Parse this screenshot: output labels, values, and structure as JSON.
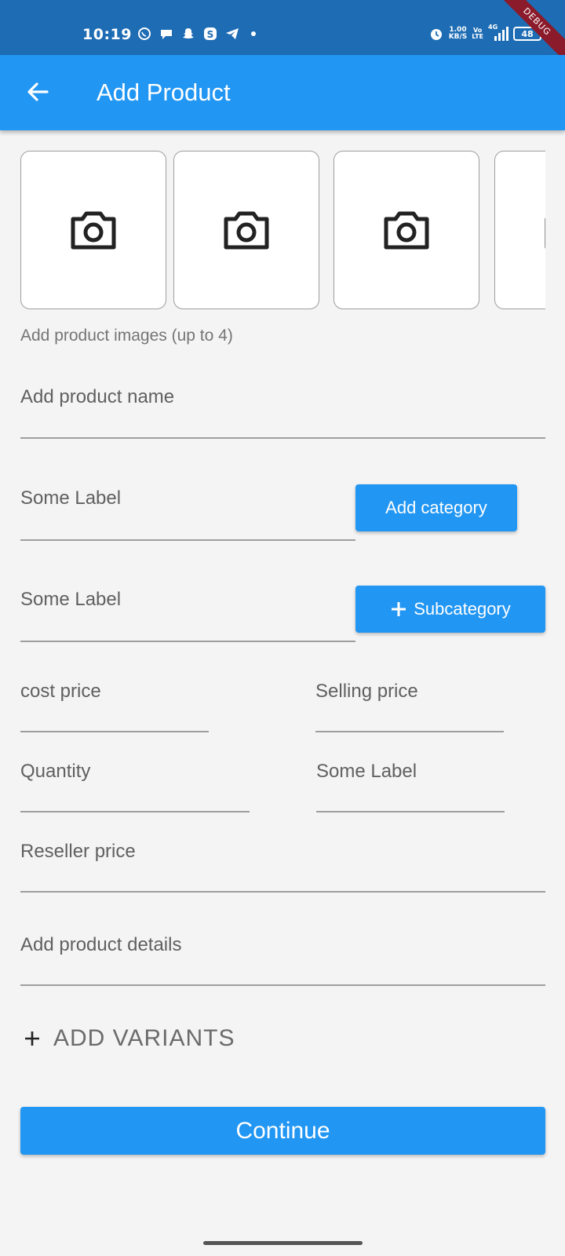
{
  "status_bar": {
    "time": "10:19",
    "speed": "1.00",
    "speed_unit": "KB/S",
    "volte_top": "Vo",
    "volte_bottom": "LTE",
    "network": "4G",
    "battery": "48",
    "debug_label": "DEBUG"
  },
  "app_bar": {
    "title": "Add Product"
  },
  "images": {
    "helper": "Add product images (up to 4)"
  },
  "form": {
    "product_name": "Add product name",
    "category_label": "Some Label",
    "add_category_button": "Add category",
    "subcategory_label": "Some Label",
    "subcategory_button": "Subcategory",
    "cost_price": "cost price",
    "selling_price": "Selling price",
    "quantity": "Quantity",
    "extra_label": "Some Label",
    "reseller_price": "Reseller price",
    "product_details": "Add product details",
    "add_variants": "ADD VARIANTS",
    "continue_button": "Continue"
  },
  "colors": {
    "primary": "#2196f3",
    "status_bar": "#1d6cb4",
    "background": "#f4f4f4"
  }
}
